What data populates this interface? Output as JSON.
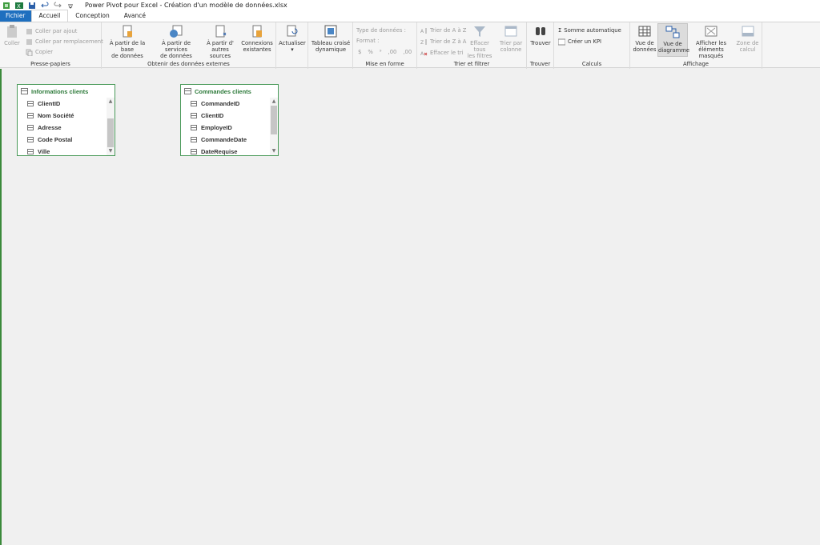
{
  "window": {
    "title": "Power Pivot pour Excel - Création d'un modèle de données.xlsx"
  },
  "tabs": [
    {
      "label": "Fichier"
    },
    {
      "label": "Accueil"
    },
    {
      "label": "Conception"
    },
    {
      "label": "Avancé"
    }
  ],
  "ribbon": {
    "clipboard": {
      "label": "Presse-papiers",
      "paste": "Coller",
      "paste_append": "Coller par ajout",
      "paste_replace": "Coller par remplacement",
      "copy": "Copier"
    },
    "external": {
      "label": "Obtenir des données externes",
      "from_db_1": "À partir de la base",
      "from_db_2": "de données",
      "from_services_1": "À partir de services",
      "from_services_2": "de données",
      "from_other_1": "À partir d'",
      "from_other_2": "autres sources",
      "existing_1": "Connexions",
      "existing_2": "existantes"
    },
    "refresh": {
      "label": "Actualiser"
    },
    "pivot": {
      "line1": "Tableau croisé",
      "line2": "dynamique"
    },
    "format": {
      "label": "Mise en forme",
      "datatype": "Type de données :",
      "format": "Format :",
      "currency": "$",
      "percent": "%",
      "thousands": "⁹",
      "inc_dec": ",00",
      "dec_dec": ",00"
    },
    "sort": {
      "label": "Trier et filtrer",
      "sort_az": "Trier de A à Z",
      "sort_za": "Trier de Z à A",
      "clear_sort": "Effacer le tri",
      "clear_filters_1": "Effacer tous",
      "clear_filters_2": "les filtres",
      "sort_by_col_1": "Trier par",
      "sort_by_col_2": "colonne"
    },
    "find": {
      "label": "Trouver",
      "button": "Trouver"
    },
    "calc": {
      "label": "Calculs",
      "autosum": "Somme automatique",
      "kpi": "Créer un KPI"
    },
    "view": {
      "label": "Affichage",
      "data_view_1": "Vue de",
      "data_view_2": "données",
      "diagram_view_1": "Vue de",
      "diagram_view_2": "diagramme",
      "show_hidden_1": "Afficher les",
      "show_hidden_2": "éléments masqués",
      "calc_area_1": "Zone de",
      "calc_area_2": "calcul"
    }
  },
  "diagram": {
    "tables": [
      {
        "title": "Informations clients",
        "fields": [
          "ClientID",
          "Nom Société",
          "Adresse",
          "Code Postal",
          "Ville"
        ]
      },
      {
        "title": "Commandes clients",
        "fields": [
          "CommandeID",
          "ClientID",
          "EmployeID",
          "CommandeDate",
          "DateRequise"
        ]
      }
    ]
  },
  "colors": {
    "accent_green": "#2d7a3a",
    "file_tab_blue": "#1e6fbf"
  }
}
